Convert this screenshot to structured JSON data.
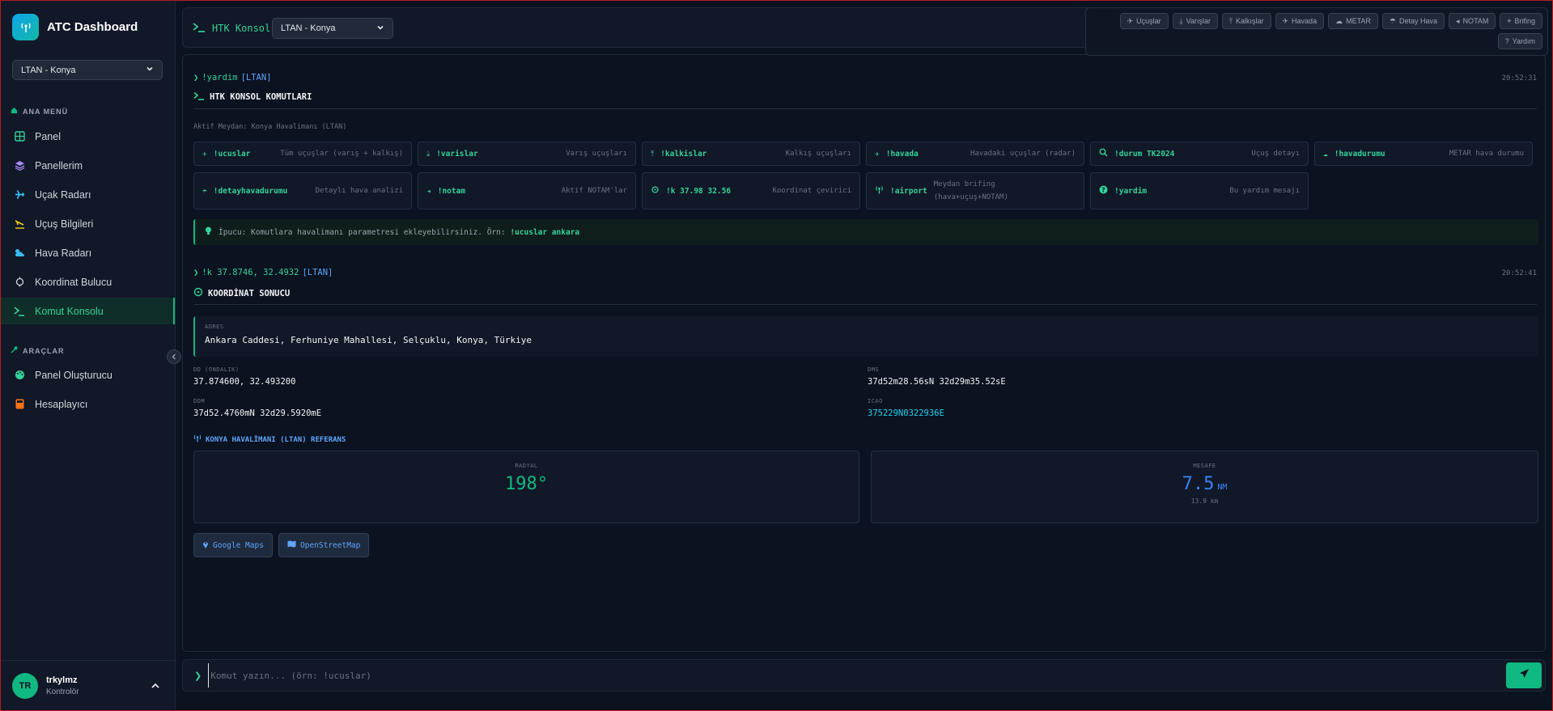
{
  "app": {
    "title": "ATC Dashboard"
  },
  "sidebar": {
    "station_select": "LTAN - Konya",
    "main_menu_label": "ANA MENÜ",
    "items": [
      {
        "label": "Panel",
        "icon": "grid-icon"
      },
      {
        "label": "Panellerim",
        "icon": "layers-icon"
      },
      {
        "label": "Uçak Radarı",
        "icon": "plane-icon"
      },
      {
        "label": "Uçuş Bilgileri",
        "icon": "plane-landing-icon"
      },
      {
        "label": "Hava Radarı",
        "icon": "cloud-sun-icon"
      },
      {
        "label": "Koordinat Bulucu",
        "icon": "crosshair-icon"
      },
      {
        "label": "Komut Konsolu",
        "icon": "terminal-icon",
        "active": true
      }
    ],
    "tools_label": "ARAÇLAR",
    "tools": [
      {
        "label": "Panel Oluşturucu",
        "icon": "palette-icon"
      },
      {
        "label": "Hesaplayıcı",
        "icon": "calculator-icon"
      }
    ],
    "user": {
      "initials": "TR",
      "name": "trkylmz",
      "role": "Kontrolör"
    }
  },
  "topbar": {
    "title": "HTK Konsol",
    "station_select": "LTAN - Konya",
    "quick_buttons": [
      "Uçuşlar",
      "Varışlar",
      "Kalkışlar",
      "Havada",
      "METAR",
      "Detay Hava",
      "NOTAM",
      "Brifing",
      "Yardım"
    ]
  },
  "console": {
    "block1": {
      "command": "!yardim",
      "tag": "[LTAN]",
      "timestamp": "20:52:31",
      "heading": "HTK KONSOL KOMUTLARI",
      "active_field": "Aktif Meydan: Konya Havalimanı (LTAN)",
      "commands": [
        {
          "name": "!ucuslar",
          "desc": "Tüm uçuşlar (varış + kalkış)"
        },
        {
          "name": "!varislar",
          "desc": "Varış uçuşları"
        },
        {
          "name": "!kalkislar",
          "desc": "Kalkış uçuşları"
        },
        {
          "name": "!havada",
          "desc": "Havadaki uçuşlar (radar)"
        },
        {
          "name": "!durum TK2024",
          "desc": "Uçuş detayı"
        },
        {
          "name": "!havadurumu",
          "desc": "METAR hava durumu"
        },
        {
          "name": "!detayhavadurumu",
          "desc": "Detaylı hava analizi"
        },
        {
          "name": "!notam",
          "desc": "Aktif NOTAM'lar"
        },
        {
          "name": "!k 37.98 32.56",
          "desc": "Koordinat çevirici"
        },
        {
          "name": "!airport",
          "desc": "Meydan brifing",
          "desc2": "(hava+uçuş+NOTAM)"
        },
        {
          "name": "!yardim",
          "desc": "Bu yardım mesajı"
        }
      ],
      "tip_text": "İpucu: Komutlara havalimanı parametresi ekleyebilirsiniz. Örn:",
      "tip_example": "!ucuslar ankara"
    },
    "block2": {
      "command": "!k 37.8746, 32.4932",
      "tag": "[LTAN]",
      "timestamp": "20:52:41",
      "heading": "KOORDİNAT SONUCU",
      "address_label": "ADRES",
      "address": "Ankara Caddesi, Ferhuniye Mahallesi, Selçuklu, Konya, Türkiye",
      "dd_label": "DD (ONDALIK)",
      "dd": "37.874600, 32.493200",
      "dms_label": "DMS",
      "dms": "37d52m28.56sN 32d29m35.52sE",
      "ddm_label": "DDM",
      "ddm": "37d52.4760mN 32d29.5920mE",
      "icao_label": "ICAO",
      "icao": "375229N0322936E",
      "ref_title": "KONYA HAVALİMANI (LTAN) REFERANS",
      "radial_label": "RADYAL",
      "radial": "198°",
      "distance_label": "MESAFE",
      "distance": "7.5",
      "distance_unit": "NM",
      "distance_km": "13.9 km",
      "google_maps": "Google Maps",
      "osm": "OpenStreetMap"
    }
  },
  "input": {
    "placeholder": "Komut yazın... (örn: !ucuslar)"
  },
  "colors": {
    "accent": "#10b981",
    "link": "#3b82f6",
    "background": "#0b1220"
  }
}
